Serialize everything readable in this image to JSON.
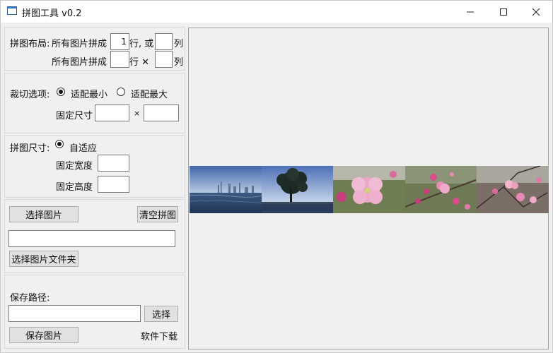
{
  "window": {
    "title": "拼图工具 v0.2",
    "minimize": "—",
    "maximize": "☐",
    "close": "✕"
  },
  "layout": {
    "label": "拼图布局:",
    "row_prefix_1": "所有图片拼成",
    "rows_value": "1",
    "row_suffix_1": "行, 或",
    "cols_value": "",
    "col_suffix_1": "列",
    "row_prefix_2": "所有图片拼成",
    "grid_rows_value": "",
    "grid_rows_suffix": "行 ✕",
    "grid_cols_value": "",
    "grid_cols_suffix": "列"
  },
  "crop": {
    "label": "裁切选项:",
    "option_min": "适配最小",
    "option_max": "适配最大",
    "fixed_size_label": "固定尺寸",
    "width_value": "",
    "times": "×",
    "height_value": ""
  },
  "size": {
    "label": "拼图尺寸:",
    "adaptive": "自适应",
    "fixed_width_label": "固定宽度",
    "fixed_width_value": "",
    "fixed_height_label": "固定高度",
    "fixed_height_value": ""
  },
  "images": {
    "select_button": "选择图片",
    "clear_button": "清空拼图",
    "folder_path_value": "",
    "select_folder_button": "选择图片文件夹"
  },
  "save": {
    "label": "保存路径:",
    "path_value": "",
    "browse_button": "选择",
    "save_button": "保存图片",
    "download_link": "软件下载"
  },
  "preview": {
    "tiles": [
      "city-skyline-photo",
      "tree-by-water-photo",
      "pink-blossom-closeup-photo",
      "pink-blossom-branch-photo",
      "blossom-twigs-photo"
    ]
  },
  "colors": {
    "background": "#f0f0f0",
    "button": "#e1e1e1",
    "border": "#adadad"
  }
}
